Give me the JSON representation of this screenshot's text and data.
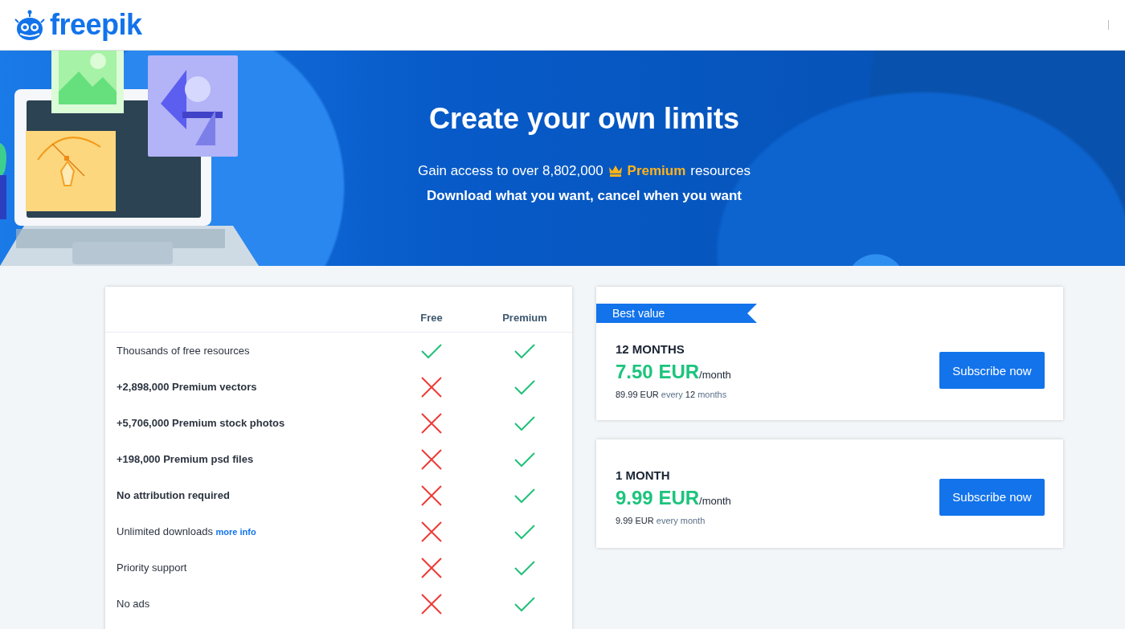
{
  "header": {
    "logo_text": "freepik"
  },
  "hero": {
    "title": "Create your own limits",
    "subtitle_before": "Gain access to over 8,802,000",
    "subtitle_highlight": "Premium",
    "subtitle_after": "resources",
    "tagline": "Download what you want, cancel when you want"
  },
  "comparison": {
    "columns": [
      "Free",
      "Premium"
    ],
    "rows": [
      {
        "feature": "Thousands of free resources",
        "bold": false,
        "free": true,
        "premium": true
      },
      {
        "feature": "+2,898,000 Premium vectors",
        "bold": true,
        "free": false,
        "premium": true
      },
      {
        "feature": "+5,706,000 Premium stock photos",
        "bold": true,
        "free": false,
        "premium": true
      },
      {
        "feature": "+198,000 Premium psd files",
        "bold": true,
        "free": false,
        "premium": true
      },
      {
        "feature": "No attribution required",
        "bold": true,
        "free": false,
        "premium": true
      },
      {
        "feature": "Unlimited downloads",
        "link": "more info",
        "bold": false,
        "free": false,
        "premium": true
      },
      {
        "feature": "Priority support",
        "bold": false,
        "free": false,
        "premium": true
      },
      {
        "feature": "No ads",
        "bold": false,
        "free": false,
        "premium": true
      }
    ]
  },
  "plans": [
    {
      "badge": "Best value",
      "period": "12 MONTHS",
      "price": "7.50 EUR",
      "unit": "/month",
      "billing": "**89.99 EUR** every **12** months",
      "button": "Subscribe now"
    },
    {
      "period": "1 MONTH",
      "price": "9.99 EUR",
      "unit": "/month",
      "billing": "**9.99 EUR** every month",
      "button": "Subscribe now"
    }
  ]
}
